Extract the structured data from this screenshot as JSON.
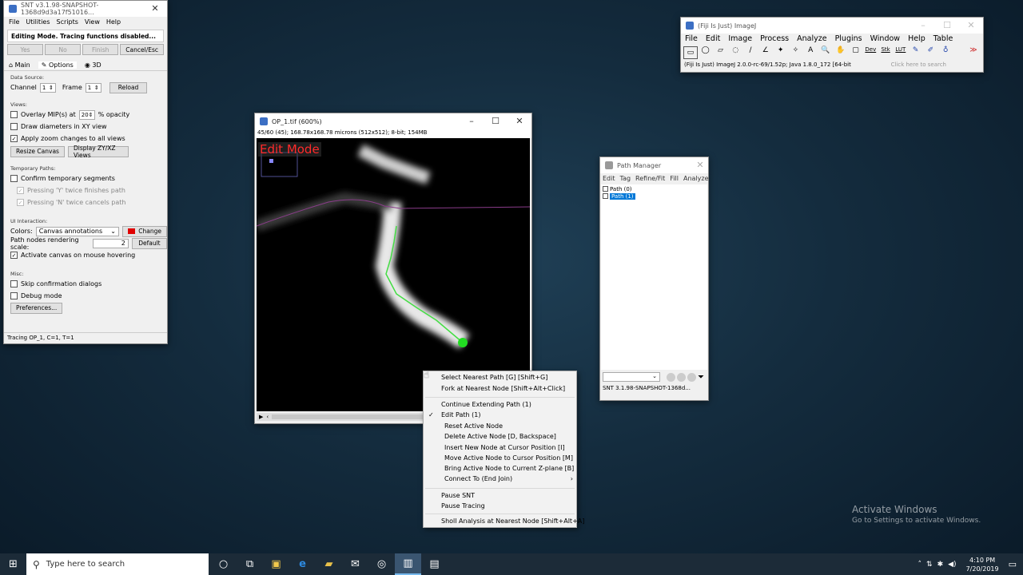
{
  "snt": {
    "title": "SNT v3.1.98-SNAPSHOT-1368d9d3a17f51016...",
    "menu": [
      "File",
      "Utilities",
      "Scripts",
      "View",
      "Help"
    ],
    "status_msg": "Editing Mode. Tracing functions disabled...",
    "buttons": [
      "Yes",
      "No",
      "Finish",
      "Cancel/Esc"
    ],
    "tabs": [
      "Main",
      "Options",
      "3D"
    ],
    "data_source_label": "Data Source:",
    "channel_label": "Channel",
    "channel_value": "1",
    "frame_label": "Frame",
    "frame_value": "1",
    "reload": "Reload",
    "views_label": "Views:",
    "overlay_mip": "Overlay MIP(s) at",
    "overlay_value": "20",
    "opacity": "% opacity",
    "draw_diameters": "Draw diameters in XY view",
    "apply_zoom": "Apply zoom changes to all views",
    "resize_canvas": "Resize Canvas",
    "display_views": "Display ZY/XZ Views",
    "temp_paths_label": "Temporary Paths:",
    "confirm_temp": "Confirm temporary segments",
    "pressing_y": "Pressing 'Y' twice finishes path",
    "pressing_n": "Pressing 'N' twice cancels path",
    "ui_label": "UI Interaction:",
    "colors_label": "Colors:",
    "colors_value": "Canvas annotations",
    "change": "Change",
    "path_nodes": "Path nodes rendering scale:",
    "path_nodes_value": "2",
    "default": "Default",
    "activate_canvas": "Activate canvas on mouse hovering",
    "misc_label": "Misc:",
    "skip_confirm": "Skip confirmation dialogs",
    "debug_mode": "Debug mode",
    "preferences": "Preferences...",
    "status": "Tracing OP_1, C=1, T=1"
  },
  "image_window": {
    "title": "OP_1.tif (600%)",
    "info": "45/60 (45); 168.78x168.78 microns (512x512); 8-bit; 154MB",
    "edit_mode": "Edit Mode"
  },
  "imagej": {
    "title": "(Fiji Is Just) ImageJ",
    "menu": [
      "File",
      "Edit",
      "Image",
      "Process",
      "Analyze",
      "Plugins",
      "Window",
      "Help",
      "Table"
    ],
    "tools": [
      "▭",
      "◯",
      "▱",
      "◌",
      "∕",
      "∠",
      "✦",
      "✧",
      "A",
      "🔍",
      "✋",
      "▢",
      "Dev",
      "Stk",
      "LUT",
      "✎",
      "✐",
      "♁",
      "≫"
    ],
    "status": "(Fiji Is Just) ImageJ 2.0.0-rc-69/1.52p; Java 1.8.0_172 [64-bit",
    "search": "Click here to search"
  },
  "path_manager": {
    "title": "Path Manager",
    "menu": [
      "Edit",
      "Tag",
      "Refine/Fit",
      "Fill",
      "Analyze"
    ],
    "paths": [
      "Path (0)",
      "Path (1)"
    ],
    "footer": "SNT 3.1.98-SNAPSHOT-1368d..."
  },
  "context_menu": {
    "items": [
      {
        "label": "Select Nearest Path  [G] [Shift+G]"
      },
      {
        "label": "Fork at Nearest Node  [Shift+Alt+Click]"
      },
      {
        "label": "Continue Extending Path (1)"
      },
      {
        "label": "Edit Path (1)",
        "checked": "✓"
      },
      {
        "label": "Reset Active Node"
      },
      {
        "label": "Delete Active Node  [D, Backspace]"
      },
      {
        "label": "Insert New Node at Cursor Position  [I]"
      },
      {
        "label": "Move Active Node to Cursor Position  [M]"
      },
      {
        "label": "Bring Active Node to Current Z-plane  [B]"
      },
      {
        "label": "Connect To (End Join)",
        "arrow": "›"
      },
      {
        "label": "Pause SNT"
      },
      {
        "label": "Pause Tracing"
      },
      {
        "label": "Sholl Analysis at Nearest Node  [Shift+Alt+A]"
      }
    ]
  },
  "watermark": {
    "line1": "Activate Windows",
    "line2": "Go to Settings to activate Windows."
  },
  "taskbar": {
    "search_placeholder": "Type here to search",
    "time": "4:10 PM",
    "date": "7/20/2019"
  }
}
